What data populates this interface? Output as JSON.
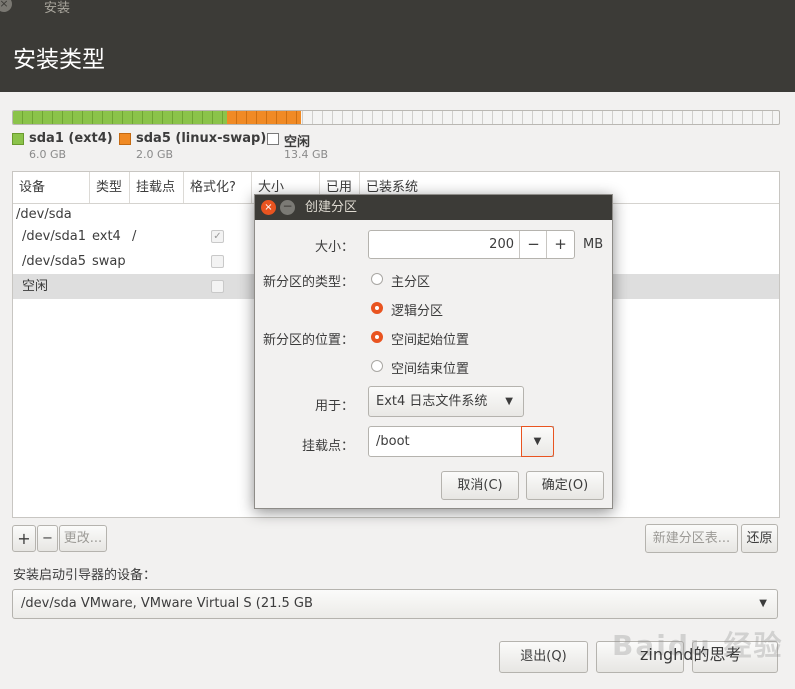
{
  "window": {
    "title": "安装",
    "close_glyph": "×"
  },
  "header": {
    "title": "安装类型"
  },
  "partition_bar": {
    "colors": {
      "sda1": "#8bc34a",
      "sda5": "#f08a24",
      "free": "#f4f4f3"
    },
    "fractions": {
      "sda1": 0.279,
      "sda5": 0.093,
      "free": 0.628
    }
  },
  "legend": [
    {
      "name": "sda1 (ext4)",
      "size": "6.0 GB",
      "color": "#8bc34a"
    },
    {
      "name": "sda5 (linux-swap)",
      "size": "2.0 GB",
      "color": "#f08a24"
    },
    {
      "name": "空闲",
      "size": "13.4 GB",
      "color": "#ffffff"
    }
  ],
  "table": {
    "columns": [
      "设备",
      "类型",
      "挂载点",
      "格式化?",
      "大小",
      "已用",
      "已装系统"
    ],
    "rows": [
      {
        "device": "/dev/sda",
        "type": "",
        "mount": ""
      },
      {
        "device": "/dev/sda1",
        "type": "ext4",
        "mount": "/"
      },
      {
        "device": "/dev/sda5",
        "type": "swap",
        "mount": ""
      },
      {
        "device": "空闲",
        "type": "",
        "mount": ""
      }
    ]
  },
  "table_buttons": {
    "add": "+",
    "remove": "−",
    "change": "更改...",
    "new_table": "新建分区表...",
    "revert": "还原"
  },
  "boot": {
    "label": "安装启动引导器的设备：",
    "value": "/dev/sda   VMware, VMware Virtual S (21.5 GB",
    "arrow": "▼"
  },
  "footer": {
    "quit": "退出(Q)"
  },
  "watermark": {
    "baidu": "Baidu 经验",
    "wechat": "zinghd的思考"
  },
  "dialog": {
    "title": "创建分区",
    "close_glyph": "×",
    "min_glyph": "−",
    "size_label": "大小：",
    "size_value": "200",
    "minus": "−",
    "plus": "+",
    "size_unit": "MB",
    "type_label": "新分区的类型：",
    "type_primary": "主分区",
    "type_logical": "逻辑分区",
    "location_label": "新分区的位置：",
    "location_start": "空间起始位置",
    "location_end": "空间结束位置",
    "use_label": "用于：",
    "use_value": "Ext4 日志文件系统",
    "use_arrow": "▼",
    "mount_label": "挂载点：",
    "mount_value": "/boot",
    "mount_arrow": "▼",
    "cancel": "取消(C)",
    "ok": "确定(O)"
  }
}
